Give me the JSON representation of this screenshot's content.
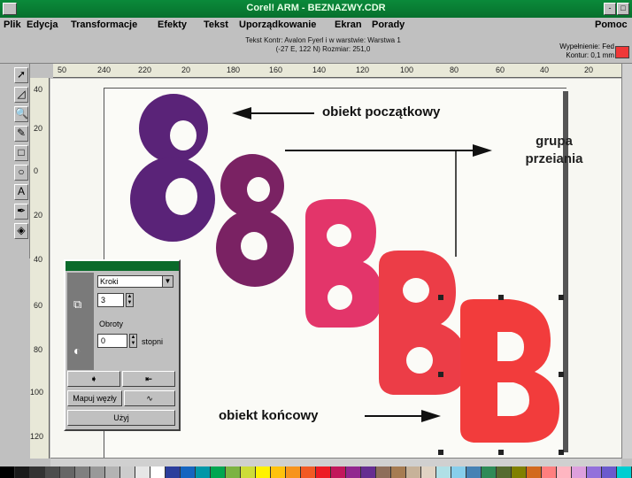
{
  "window": {
    "title": "Corel! ARM - BEZNAZWY.CDR",
    "controls": [
      "-",
      "□"
    ]
  },
  "menu": {
    "items": [
      "Plik",
      "Edycja",
      "Transformacje",
      "Efekty",
      "Tekst",
      "Uporządkowanie",
      "Ekran",
      "Porady"
    ],
    "help": "Pomoc"
  },
  "status": {
    "line1": "Tekst Kontr: Avalon Fyerl i w warstwie: Warstwa 1",
    "line2": "(-27 E, 122 N) Rozmiar: 251,0",
    "fill_label": "Wypełnienie: Fed",
    "outline_label": "Kontur: 0,1 mm",
    "fill_color": "#f03838"
  },
  "ruler": {
    "h_labels": [
      "50",
      "240",
      "220",
      "20",
      "180",
      "160",
      "140",
      "120",
      "100",
      "80",
      "60",
      "40",
      "20"
    ],
    "v_labels": [
      "40",
      "20",
      "0",
      "20",
      "40",
      "60",
      "80",
      "100",
      "120"
    ]
  },
  "tools": [
    "pick-tool-icon",
    "shape-tool-icon",
    "zoom-tool-icon",
    "pencil-tool-icon",
    "rectangle-tool-icon",
    "ellipse-tool-icon",
    "text-tool-icon",
    "outline-tool-icon",
    "fill-tool-icon"
  ],
  "annotations": {
    "start": "obiekt początkowy",
    "group_line1": "grupa",
    "group_line2": "przeiania",
    "end": "obiekt końcowy"
  },
  "blend_panel": {
    "mode": "Kroki",
    "steps": "3",
    "rotation_label": "Obroty",
    "rotation_value": "0",
    "degrees": "stopni",
    "map_nodes": "Mapuj węzły",
    "apply": "Użyj"
  },
  "objects": {
    "colors": [
      "#5a2378",
      "#7a2263",
      "#e3356a",
      "#ec3d47",
      "#f23c3c"
    ]
  },
  "palette": [
    "#000000",
    "#1a1a1a",
    "#333333",
    "#4d4d4d",
    "#666666",
    "#808080",
    "#999999",
    "#b3b3b3",
    "#cccccc",
    "#e6e6e6",
    "#ffffff",
    "#2c3e9c",
    "#1565c0",
    "#0097a7",
    "#00a651",
    "#7cb342",
    "#cddc39",
    "#fff200",
    "#ffc20e",
    "#f7941d",
    "#f15a24",
    "#ed1c24",
    "#c2185b",
    "#92278f",
    "#662d91",
    "#8e6e5a",
    "#a67c52",
    "#c7b299",
    "#e0d3c3",
    "#b0e0e6",
    "#87ceeb",
    "#4682b4",
    "#2e8b57",
    "#556b2f",
    "#808000",
    "#d2691e",
    "#ff7f7f",
    "#ffb6c1",
    "#dda0dd",
    "#9370db",
    "#6a5acd",
    "#00ced1"
  ]
}
